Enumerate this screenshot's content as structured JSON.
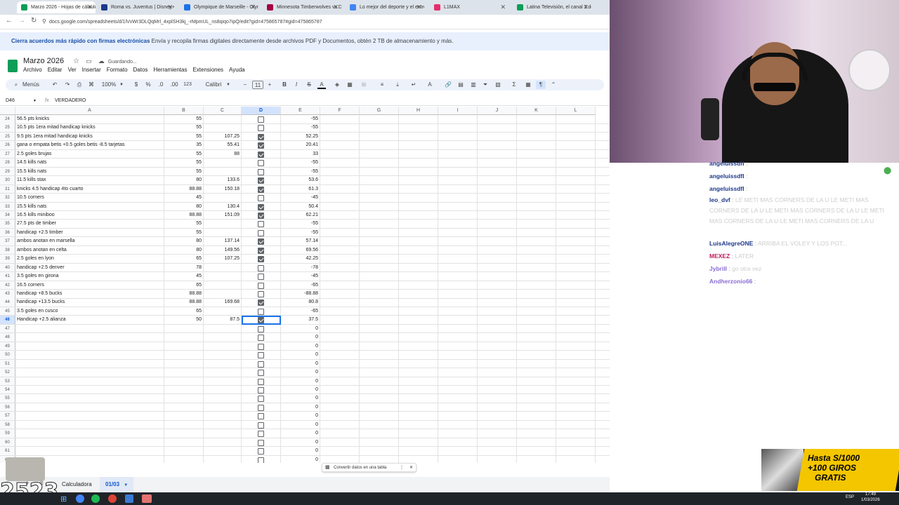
{
  "tabs": [
    {
      "label": "Marzo 2026 - Hojas de cálculo",
      "active": true,
      "color": "#0f9d58"
    },
    {
      "label": "Roma vs. Juventus | Disney+",
      "color": "#1b3a8a"
    },
    {
      "label": "Olympique de Marseille - Olym",
      "color": "#1a73e8"
    },
    {
      "label": "Minnesota Timberwolves vs De",
      "color": "#a50044"
    },
    {
      "label": "Lo mejor del deporte y el entre",
      "color": "#4285f4"
    },
    {
      "label": "L1MAX",
      "color": "#e52d6b"
    },
    {
      "label": "Latina Televisión, el canal 2 de",
      "color": "#0f9d58"
    }
  ],
  "url": "docs.google.com/spreadsheets/d/1lVvWr3DLQqMrl_4xplSH3kj_-rMpmUL_ns8qiqo7ipQ/edit?gid=475865787#gid=475865787",
  "promo": {
    "bold": "Cierra acuerdos más rápido con firmas electrónicas",
    "text": "Envía y recopila firmas digitales directamente desde archivos PDF y Documentos, obtén 2 TB de almacenamiento y más."
  },
  "doc": {
    "title": "Marzo 2026",
    "status": "Guardando..."
  },
  "menu": [
    "Archivo",
    "Editar",
    "Ver",
    "Insertar",
    "Formato",
    "Datos",
    "Herramientas",
    "Extensiones",
    "Ayuda"
  ],
  "toolbar": {
    "menus": "Menús",
    "zoom": "100%",
    "currency": "$",
    "percent": "%",
    "dec_less": ".0",
    "dec_more": ".00",
    "format_123": "123",
    "font": "Calibri",
    "font_size": "11",
    "bold": "B",
    "italic": "I",
    "strike": "S",
    "text_color": "A"
  },
  "formula": {
    "cell_ref": "D46",
    "fx": "fx",
    "value": "VERDADERO"
  },
  "columns": [
    "A",
    "B",
    "C",
    "D",
    "E",
    "F",
    "G",
    "H",
    "I",
    "J",
    "K",
    "L"
  ],
  "rows": [
    {
      "n": "24",
      "a": "56.5 pts knicks",
      "b": "55",
      "c": "",
      "d": false,
      "e": "-55"
    },
    {
      "n": "25",
      "a": "10.5 pts 1era mitad handicap knicks",
      "b": "55",
      "c": "",
      "d": false,
      "e": "-55"
    },
    {
      "n": "25",
      "a": "9.5 pts 1era mitad handicap knicks",
      "b": "55",
      "c": "107.25",
      "d": true,
      "e": "52.25"
    },
    {
      "n": "26",
      "a": "gana o empata betis +0.5 goles betis -8.5 tarjetas",
      "b": "35",
      "c": "55.41",
      "d": true,
      "e": "20.41"
    },
    {
      "n": "27",
      "a": "2.5 goles brujas",
      "b": "55",
      "c": "88",
      "d": true,
      "e": "33"
    },
    {
      "n": "28",
      "a": "14.5 kills nats",
      "b": "55",
      "c": "",
      "d": false,
      "e": "-55"
    },
    {
      "n": "29",
      "a": "15.5 kills nats",
      "b": "55",
      "c": "",
      "d": false,
      "e": "-55"
    },
    {
      "n": "30",
      "a": "11.5 kills stax",
      "b": "80",
      "c": "133.6",
      "d": true,
      "e": "53.6"
    },
    {
      "n": "31",
      "a": "knicks 4.5 handicap 4to cuarto",
      "b": "88.88",
      "c": "150.18",
      "d": true,
      "e": "61.3"
    },
    {
      "n": "32",
      "a": "10.5 corners",
      "b": "45",
      "c": "",
      "d": false,
      "e": "-45"
    },
    {
      "n": "33",
      "a": "15.5 kills nats",
      "b": "80",
      "c": "130.4",
      "d": true,
      "e": "50.4"
    },
    {
      "n": "34",
      "a": "16.5 kills miniboo",
      "b": "88.88",
      "c": "151.09",
      "d": true,
      "e": "62.21"
    },
    {
      "n": "35",
      "a": "27.5 pts de timber",
      "b": "55",
      "c": "",
      "d": false,
      "e": "-55"
    },
    {
      "n": "36",
      "a": "handicap +2.5 timber",
      "b": "55",
      "c": "",
      "d": false,
      "e": "-55"
    },
    {
      "n": "37",
      "a": "ambos anotan en marsella",
      "b": "80",
      "c": "137.14",
      "d": true,
      "e": "57.14"
    },
    {
      "n": "38",
      "a": "ambos anotan en celta",
      "b": "80",
      "c": "149.56",
      "d": true,
      "e": "69.56"
    },
    {
      "n": "39",
      "a": "2.5 goles en lyon",
      "b": "65",
      "c": "107.25",
      "d": true,
      "e": "42.25"
    },
    {
      "n": "40",
      "a": "handicap +2.5 denver",
      "b": "78",
      "c": "",
      "d": false,
      "e": "-78"
    },
    {
      "n": "41",
      "a": "3.5 goles en girona",
      "b": "45",
      "c": "",
      "d": false,
      "e": "-45"
    },
    {
      "n": "42",
      "a": "16.5 corners",
      "b": "65",
      "c": "",
      "d": false,
      "e": "-65"
    },
    {
      "n": "43",
      "a": "handicap +8.5 bucks",
      "b": "88.88",
      "c": "",
      "d": false,
      "e": "-88.88"
    },
    {
      "n": "44",
      "a": "handicap +13.5 bucks",
      "b": "88.88",
      "c": "169.68",
      "d": true,
      "e": "80.8"
    },
    {
      "n": "45",
      "a": "3.5 goles en cusco",
      "b": "65",
      "c": "",
      "d": false,
      "e": "-65"
    },
    {
      "n": "46",
      "a": "Handicap +2.5 alianza",
      "b": "50",
      "c": "87.5",
      "d": true,
      "e": "37.5",
      "selected": true
    },
    {
      "n": "47",
      "a": "",
      "b": "",
      "c": "",
      "d": false,
      "e": "0"
    },
    {
      "n": "48",
      "a": "",
      "b": "",
      "c": "",
      "d": false,
      "e": "0"
    },
    {
      "n": "49",
      "a": "",
      "b": "",
      "c": "",
      "d": false,
      "e": "0"
    },
    {
      "n": "50",
      "a": "",
      "b": "",
      "c": "",
      "d": false,
      "e": "0"
    },
    {
      "n": "51",
      "a": "",
      "b": "",
      "c": "",
      "d": false,
      "e": "0"
    },
    {
      "n": "52",
      "a": "",
      "b": "",
      "c": "",
      "d": false,
      "e": "0"
    },
    {
      "n": "53",
      "a": "",
      "b": "",
      "c": "",
      "d": false,
      "e": "0"
    },
    {
      "n": "54",
      "a": "",
      "b": "",
      "c": "",
      "d": false,
      "e": "0"
    },
    {
      "n": "55",
      "a": "",
      "b": "",
      "c": "",
      "d": false,
      "e": "0"
    },
    {
      "n": "56",
      "a": "",
      "b": "",
      "c": "",
      "d": false,
      "e": "0"
    },
    {
      "n": "57",
      "a": "",
      "b": "",
      "c": "",
      "d": false,
      "e": "0"
    },
    {
      "n": "58",
      "a": "",
      "b": "",
      "c": "",
      "d": false,
      "e": "0"
    },
    {
      "n": "59",
      "a": "",
      "b": "",
      "c": "",
      "d": false,
      "e": "0"
    },
    {
      "n": "60",
      "a": "",
      "b": "",
      "c": "",
      "d": false,
      "e": "0"
    },
    {
      "n": "61",
      "a": "",
      "b": "",
      "c": "",
      "d": false,
      "e": "0"
    },
    {
      "n": "62",
      "a": "",
      "b": "",
      "c": "",
      "d": false,
      "e": "0"
    }
  ],
  "tooltip": {
    "text": "Convertir datos en una tabla"
  },
  "sheets": [
    {
      "label": "Calculadora"
    },
    {
      "label": "01/03",
      "active": true
    }
  ],
  "overlay_number": "2523",
  "chat": [
    {
      "nick": "angeluissdfl",
      "text": ""
    },
    {
      "nick": "angeluissdfl",
      "text": ""
    },
    {
      "nick": "angeluissdfl",
      "text": ""
    },
    {
      "nick": "leo_dvf",
      "text": "LE METI MAS CORNERS DE LA U LE METI MAS CORNERS DE LA U LE METI MAS CORNERS DE LA U LE METI MAS CORNERS DE LA U LE METI MAS CORNERS DE LA U"
    },
    {
      "nick": "LuisAlegreONE",
      "text": "ARRIBA EL VOLEY Y LOS POT..."
    },
    {
      "nick": "MEXEZ",
      "text": "LATER"
    },
    {
      "nick": "Jybrill",
      "text": "go otra vez"
    },
    {
      "nick": "Andherzonio66",
      "text": ""
    }
  ],
  "ad": {
    "line1": "Hasta S/1000",
    "line2": "+100 GIROS",
    "line3": "GRATIS"
  },
  "clock": {
    "time": "17:49",
    "date": "1/03/2026",
    "lang": "ESP"
  }
}
